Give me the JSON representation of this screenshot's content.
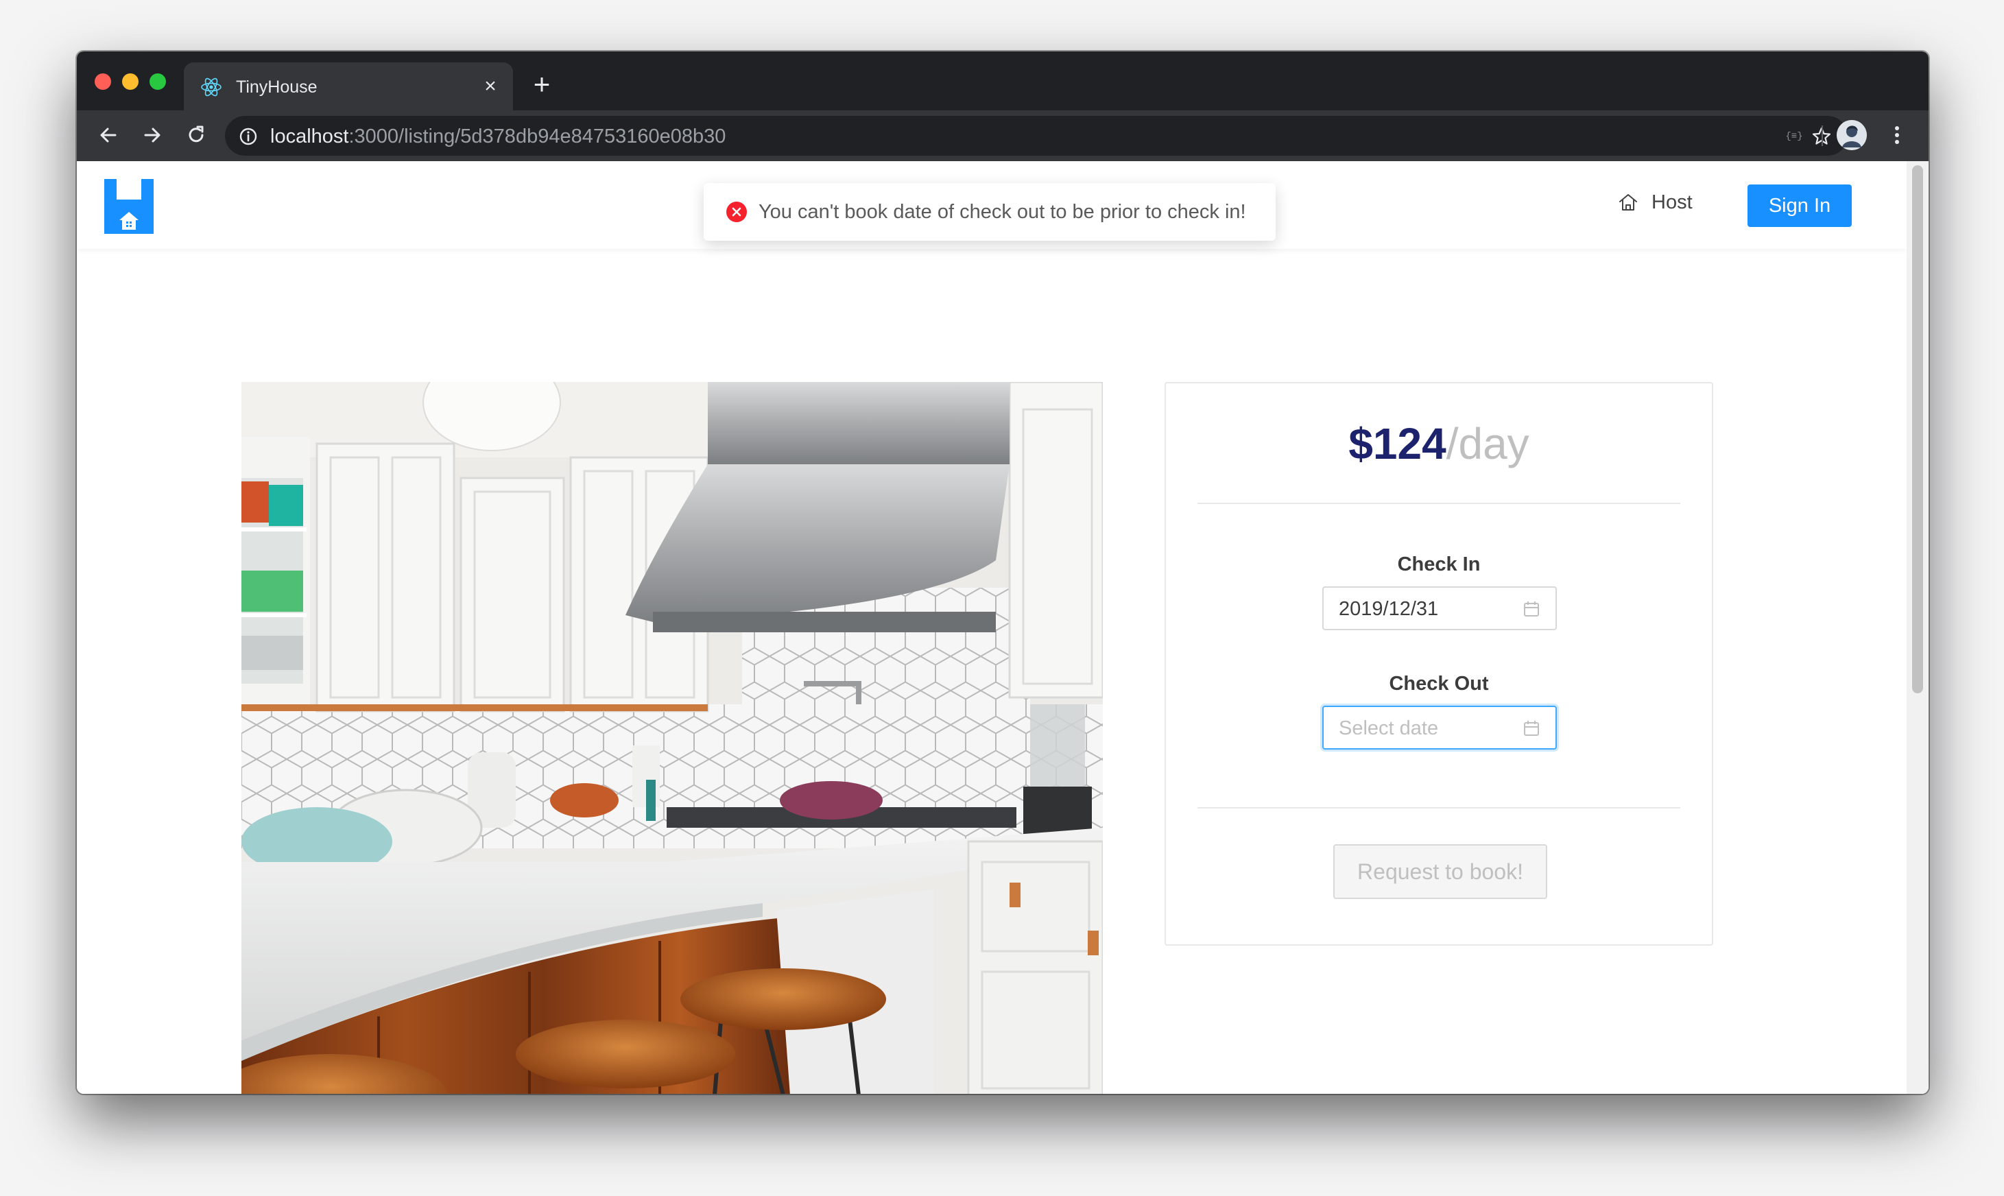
{
  "browser": {
    "tab_title": "TinyHouse",
    "tab_icon": "react-logo-icon",
    "url_host": "localhost",
    "url_path": ":3000/listing/5d378db94e84753160e08b30"
  },
  "header": {
    "host_label": "Host",
    "signin_label": "Sign In"
  },
  "notification": {
    "type": "error",
    "message": "You can't book date of check out to be prior to check in!"
  },
  "listing": {
    "image_subject": "kitchen-photo"
  },
  "booking": {
    "price": "$124",
    "price_unit": "/day",
    "check_in_label": "Check In",
    "check_in_value": "2019/12/31",
    "check_out_label": "Check Out",
    "check_out_placeholder": "Select date",
    "request_label": "Request to book!"
  },
  "colors": {
    "brand_blue": "#1890ff",
    "price_navy": "#1d226c",
    "error_red": "#f5222d"
  }
}
